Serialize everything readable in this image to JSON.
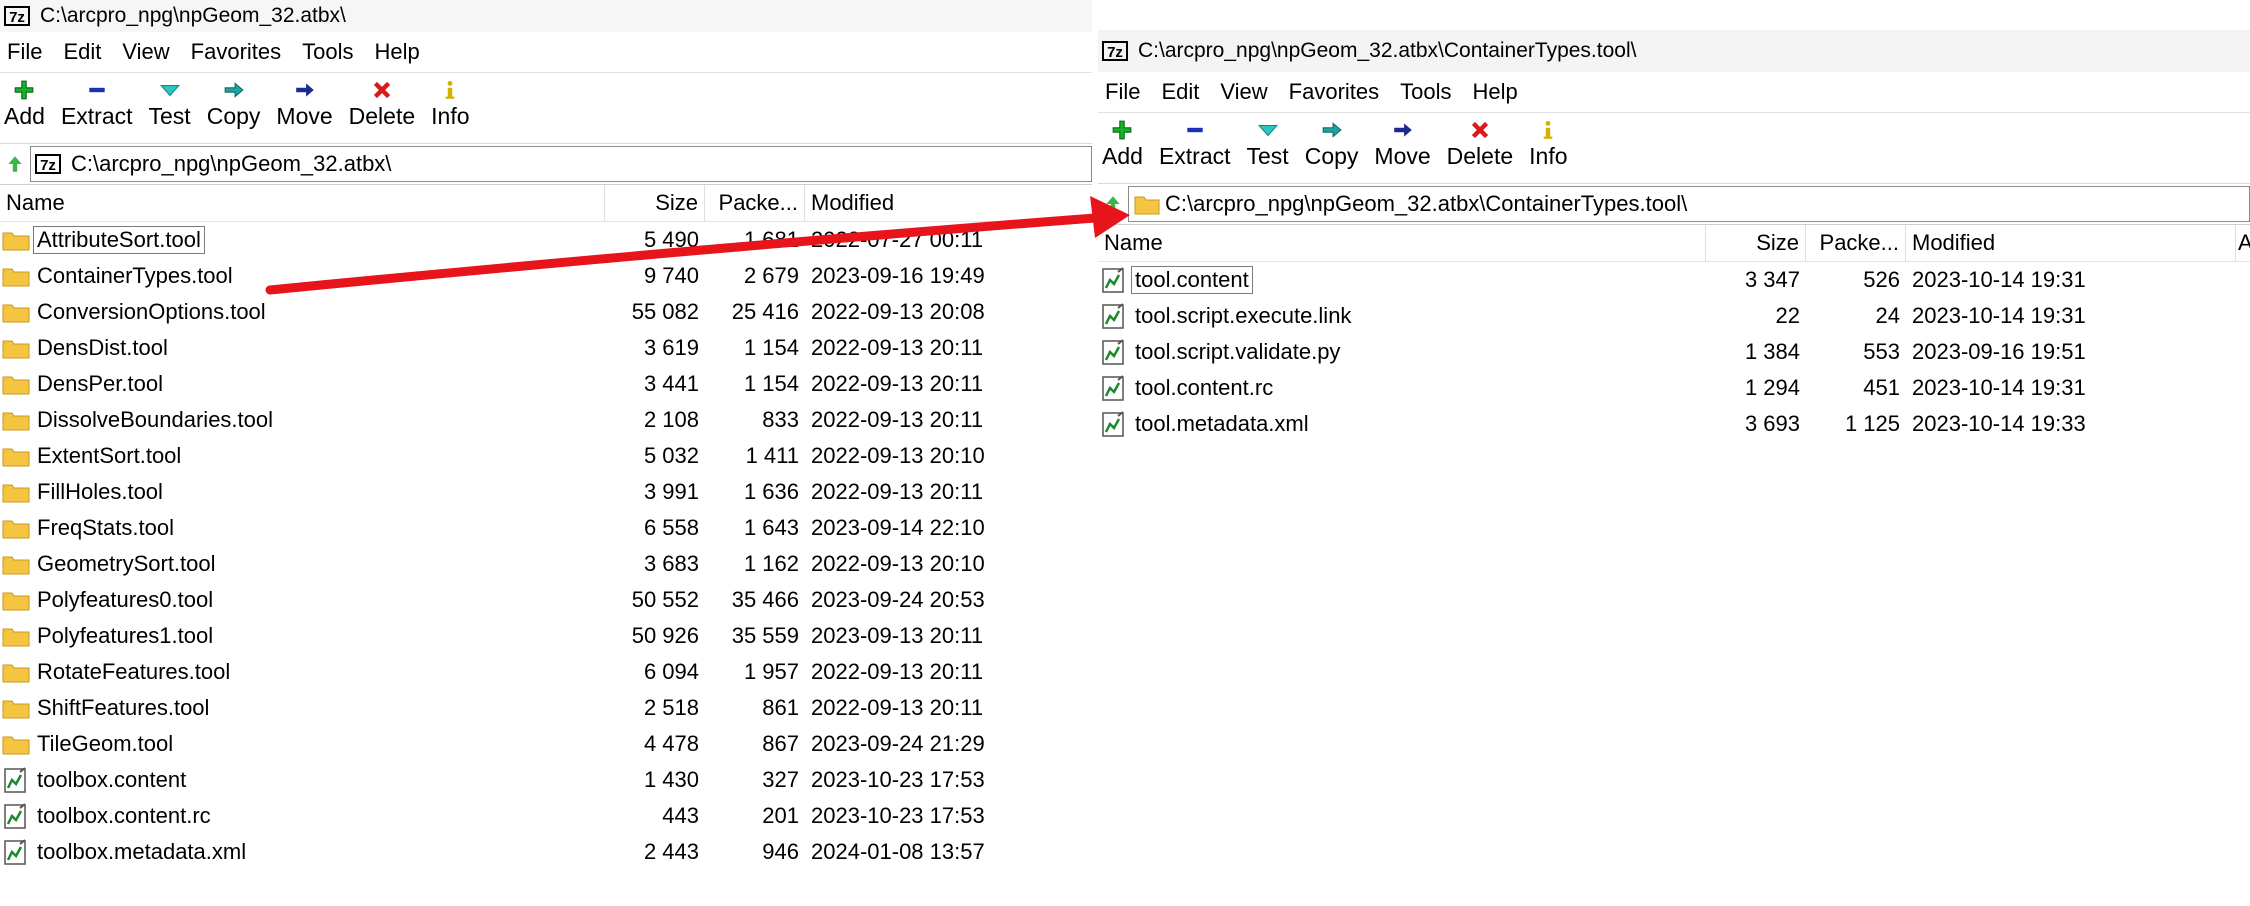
{
  "left_window": {
    "title": "C:\\arcpro_npg\\npGeom_32.atbx\\",
    "icon_text": "7z",
    "menu": [
      "File",
      "Edit",
      "View",
      "Favorites",
      "Tools",
      "Help"
    ],
    "toolbar": [
      {
        "label": "Add",
        "icon": "add-icon"
      },
      {
        "label": "Extract",
        "icon": "extract-icon"
      },
      {
        "label": "Test",
        "icon": "test-icon"
      },
      {
        "label": "Copy",
        "icon": "copy-icon"
      },
      {
        "label": "Move",
        "icon": "move-icon"
      },
      {
        "label": "Delete",
        "icon": "delete-icon"
      },
      {
        "label": "Info",
        "icon": "info-icon"
      }
    ],
    "address": "C:\\arcpro_npg\\npGeom_32.atbx\\",
    "columns": {
      "name": "Name",
      "size": "Size",
      "packed": "Packe...",
      "modified": "Modified"
    },
    "rows": [
      {
        "name": "AttributeSort.tool",
        "type": "folder",
        "size": "5 490",
        "packed": "1 681",
        "modified": "2022-07-27 00:11"
      },
      {
        "name": "ContainerTypes.tool",
        "type": "folder",
        "size": "9 740",
        "packed": "2 679",
        "modified": "2023-09-16 19:49"
      },
      {
        "name": "ConversionOptions.tool",
        "type": "folder",
        "size": "55 082",
        "packed": "25 416",
        "modified": "2022-09-13 20:08"
      },
      {
        "name": "DensDist.tool",
        "type": "folder",
        "size": "3 619",
        "packed": "1 154",
        "modified": "2022-09-13 20:11"
      },
      {
        "name": "DensPer.tool",
        "type": "folder",
        "size": "3 441",
        "packed": "1 154",
        "modified": "2022-09-13 20:11"
      },
      {
        "name": "DissolveBoundaries.tool",
        "type": "folder",
        "size": "2 108",
        "packed": "833",
        "modified": "2022-09-13 20:11"
      },
      {
        "name": "ExtentSort.tool",
        "type": "folder",
        "size": "5 032",
        "packed": "1 411",
        "modified": "2022-09-13 20:10"
      },
      {
        "name": "FillHoles.tool",
        "type": "folder",
        "size": "3 991",
        "packed": "1 636",
        "modified": "2022-09-13 20:11"
      },
      {
        "name": "FreqStats.tool",
        "type": "folder",
        "size": "6 558",
        "packed": "1 643",
        "modified": "2023-09-14 22:10"
      },
      {
        "name": "GeometrySort.tool",
        "type": "folder",
        "size": "3 683",
        "packed": "1 162",
        "modified": "2022-09-13 20:10"
      },
      {
        "name": "Polyfeatures0.tool",
        "type": "folder",
        "size": "50 552",
        "packed": "35 466",
        "modified": "2023-09-24 20:53"
      },
      {
        "name": "Polyfeatures1.tool",
        "type": "folder",
        "size": "50 926",
        "packed": "35 559",
        "modified": "2023-09-13 20:11"
      },
      {
        "name": "RotateFeatures.tool",
        "type": "folder",
        "size": "6 094",
        "packed": "1 957",
        "modified": "2022-09-13 20:11"
      },
      {
        "name": "ShiftFeatures.tool",
        "type": "folder",
        "size": "2 518",
        "packed": "861",
        "modified": "2022-09-13 20:11"
      },
      {
        "name": "TileGeom.tool",
        "type": "folder",
        "size": "4 478",
        "packed": "867",
        "modified": "2023-09-24 21:29"
      },
      {
        "name": "toolbox.content",
        "type": "file",
        "size": "1 430",
        "packed": "327",
        "modified": "2023-10-23 17:53"
      },
      {
        "name": "toolbox.content.rc",
        "type": "file",
        "size": "443",
        "packed": "201",
        "modified": "2023-10-23 17:53"
      },
      {
        "name": "toolbox.metadata.xml",
        "type": "file",
        "size": "2 443",
        "packed": "946",
        "modified": "2024-01-08 13:57"
      }
    ]
  },
  "right_window": {
    "title": "C:\\arcpro_npg\\npGeom_32.atbx\\ContainerTypes.tool\\",
    "icon_text": "7z",
    "menu": [
      "File",
      "Edit",
      "View",
      "Favorites",
      "Tools",
      "Help"
    ],
    "toolbar": [
      {
        "label": "Add",
        "icon": "add-icon"
      },
      {
        "label": "Extract",
        "icon": "extract-icon"
      },
      {
        "label": "Test",
        "icon": "test-icon"
      },
      {
        "label": "Copy",
        "icon": "copy-icon"
      },
      {
        "label": "Move",
        "icon": "move-icon"
      },
      {
        "label": "Delete",
        "icon": "delete-icon"
      },
      {
        "label": "Info",
        "icon": "info-icon"
      }
    ],
    "address": "C:\\arcpro_npg\\npGeom_32.atbx\\ContainerTypes.tool\\",
    "columns": {
      "name": "Name",
      "size": "Size",
      "packed": "Packe...",
      "modified": "Modified",
      "extra": "A"
    },
    "rows": [
      {
        "name": "tool.content",
        "type": "file",
        "size": "3 347",
        "packed": "526",
        "modified": "2023-10-14 19:31"
      },
      {
        "name": "tool.script.execute.link",
        "type": "file",
        "size": "22",
        "packed": "24",
        "modified": "2023-10-14 19:31"
      },
      {
        "name": "tool.script.validate.py",
        "type": "file",
        "size": "1 384",
        "packed": "553",
        "modified": "2023-09-16 19:51"
      },
      {
        "name": "tool.content.rc",
        "type": "file",
        "size": "1 294",
        "packed": "451",
        "modified": "2023-10-14 19:31"
      },
      {
        "name": "tool.metadata.xml",
        "type": "file",
        "size": "3 693",
        "packed": "1 125",
        "modified": "2023-10-14 19:33"
      }
    ]
  },
  "colors": {
    "arrow": "#e8141b",
    "folder": "#f5c542",
    "selection_outline": "#7a7a7a"
  }
}
